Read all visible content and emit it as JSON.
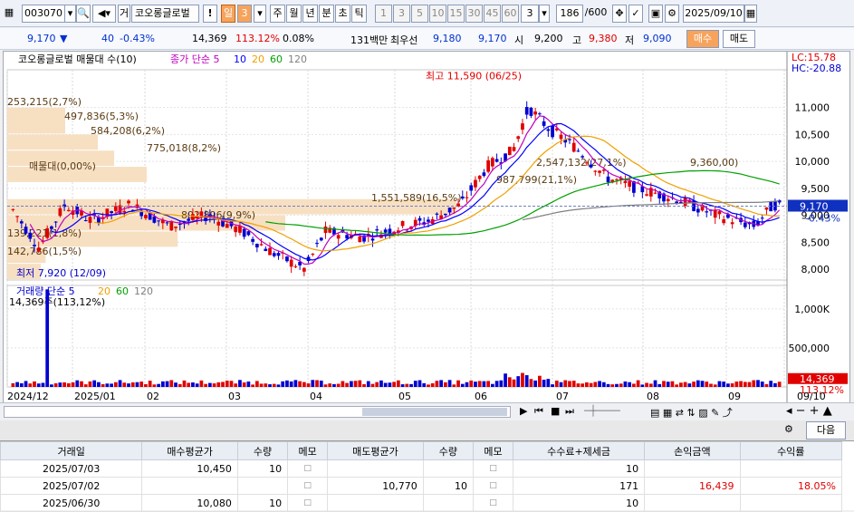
{
  "toolbar": {
    "code": "003070",
    "name": "코오롱글로벌",
    "exclaim": "!",
    "period_label": "일",
    "period_num": "3",
    "period_buttons": [
      "주",
      "월",
      "년",
      "분",
      "초",
      "틱"
    ],
    "num_buttons": [
      "1",
      "3",
      "5",
      "10",
      "15",
      "30",
      "45",
      "60"
    ],
    "tick_select": "3",
    "count": "186",
    "count_total": "/600",
    "date": "2025/09/10",
    "geo_label": "거"
  },
  "info": {
    "price": "9,170",
    "arrow": "▼",
    "change": "40",
    "change_pct": "-0.43%",
    "volume": "14,369",
    "vol_ratio": "113.12%",
    "turnover": "0.08%",
    "amount_label": "131백만",
    "pref": "최우선",
    "ask": "9,180",
    "bid": "9,170",
    "open_label": "시",
    "open": "9,200",
    "high_label": "고",
    "high": "9,380",
    "low_label": "저",
    "low": "9,090",
    "buy": "매수",
    "sell": "매도"
  },
  "chart": {
    "title": "코오롱글로벌 매물대 수(10)",
    "ma_title": "종가 단순 5",
    "ma_periods": [
      "10",
      "20",
      "60",
      "120"
    ],
    "lc": "LC:15.78",
    "hc": "HC:-20.88",
    "max_label": "최고 11,590 (06/25)",
    "min_label": "최저 7,920 (12/09)",
    "price_ticks": [
      "11,000",
      "10,500",
      "10,000",
      "9,500",
      "9,000",
      "8,500",
      "8,000"
    ],
    "cur_price": "9,170",
    "cur_pct": "-0.43%",
    "vp_labels": [
      "253,215(2,7%)",
      "497,836(5,3%)",
      "584,208(6,2%)",
      "775,018(8,2%)",
      "매물대(0,00%)",
      "892,896(9,9%)",
      "139,221(1,8%)",
      "142,786(1,5%)",
      "1,551,589(16,5%)",
      "987,799(21,1%)",
      "2,547,132(27,1%)",
      "9,360,00)"
    ],
    "vol_title": "거래량 단순 5",
    "vol_periods": [
      "20",
      "60",
      "120"
    ],
    "vol_note": "14,369주(113,12%)",
    "vol_ticks": [
      "1,000K",
      "500,000"
    ],
    "cur_vol": "14,369",
    "cur_vol_pct": "113,12%",
    "months": [
      "2024/12",
      "2025/01",
      "02",
      "03",
      "04",
      "05",
      "06",
      "07",
      "08",
      "09",
      "09/10"
    ]
  },
  "colors": {
    "up": "#e00000",
    "down": "#0000d0",
    "ma5": "#c000c0",
    "ma10": "#0000ff",
    "ma20": "#f0a000",
    "ma60": "#00a000",
    "ma120": "#808080",
    "vp": "#f7dfc2"
  },
  "nav": {
    "next": "다음"
  },
  "table": {
    "headers": [
      "거래일",
      "매수평균가",
      "수량",
      "메모",
      "매도평균가",
      "수량",
      "메모",
      "수수료+제세금",
      "손익금액",
      "수익률"
    ],
    "rows": [
      [
        "2025/07/03",
        "10,450",
        "10",
        "",
        "",
        "",
        "",
        "10",
        "",
        ""
      ],
      [
        "2025/07/02",
        "",
        "",
        "",
        "10,770",
        "10",
        "",
        "171",
        "16,439",
        "18.05%"
      ],
      [
        "2025/06/30",
        "10,080",
        "10",
        "",
        "",
        "",
        "",
        "10",
        "",
        ""
      ]
    ]
  }
}
